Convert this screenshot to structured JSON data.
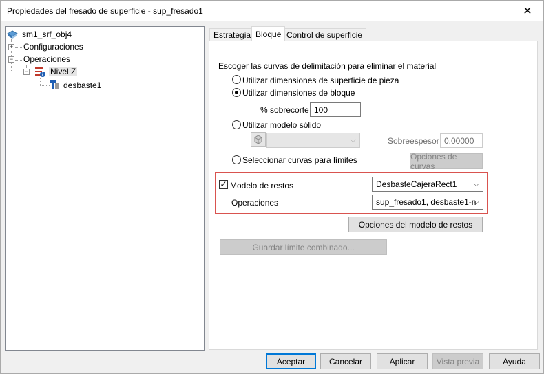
{
  "window": {
    "title": "Propiedades del fresado de superficie - sup_fresado1",
    "close": "✕"
  },
  "tree": {
    "root": "sm1_srf_obj4",
    "configuraciones": "Configuraciones",
    "operaciones": "Operaciones",
    "nivel": "Nivel Z",
    "desbaste": "desbaste1",
    "plus": "+",
    "minus": "−"
  },
  "tabs": [
    {
      "label": "Estrategia"
    },
    {
      "label": "Bloque"
    },
    {
      "label": "Control de superficie"
    }
  ],
  "panel": {
    "heading": "Escoger las curvas de delimitación para eliminar el material",
    "radio1": "Utilizar dimensiones de superficie de pieza",
    "radio2": "Utilizar dimensiones de bloque",
    "sobrecorte_label": "% sobrecorte",
    "sobrecorte_value": "100",
    "radio3": "Utilizar modelo sólido",
    "sobreespesor_label": "Sobreespesor",
    "sobreespesor_value": "0.00000",
    "radio4": "Seleccionar curvas para límites",
    "opciones_curvas": "Opciones de curvas",
    "modelo_restos_label": "Modelo de restos",
    "modelo_restos_value": "DesbasteCajeraRect1",
    "operaciones_label": "Operaciones",
    "operaciones_value": "sup_fresado1, desbaste1-n",
    "opciones_modelo": "Opciones del modelo de restos",
    "guardar_limite": "Guardar límite combinado...",
    "checkmark": "✓",
    "chevron": "⌵"
  },
  "footer": {
    "aceptar": "Aceptar",
    "cancelar": "Cancelar",
    "aplicar": "Aplicar",
    "vista_previa": "Vista previa",
    "ayuda": "Ayuda"
  },
  "colors": {
    "highlight": "#d9534f",
    "accent": "#0078d7"
  }
}
